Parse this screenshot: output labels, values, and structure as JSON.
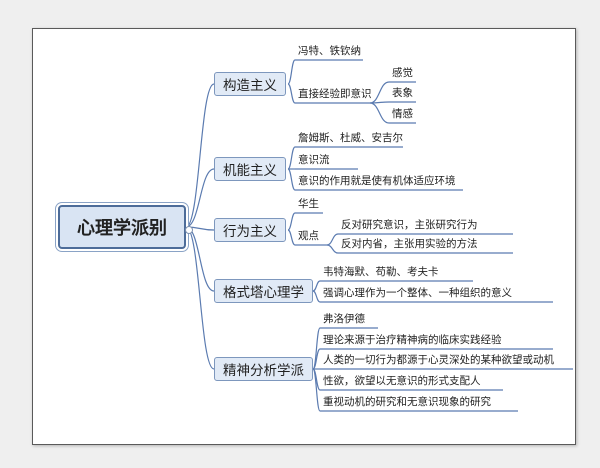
{
  "root": {
    "label": "心理学派别"
  },
  "branches": [
    {
      "label": "构造主义",
      "items": [
        {
          "label": "冯特、铁钦纳"
        },
        {
          "label": "直接经验即意识",
          "children": [
            "感觉",
            "表象",
            "情感"
          ]
        }
      ]
    },
    {
      "label": "机能主义",
      "items": [
        {
          "label": "詹姆斯、杜威、安吉尔"
        },
        {
          "label": "意识流"
        },
        {
          "label": "意识的作用就是使有机体适应环境"
        }
      ]
    },
    {
      "label": "行为主义",
      "items": [
        {
          "label": "华生"
        },
        {
          "label": "观点",
          "children": [
            "反对研究意识，主张研究行为",
            "反对内省，主张用实验的方法"
          ]
        }
      ]
    },
    {
      "label": "格式塔心理学",
      "items": [
        {
          "label": "韦特海默、苟勒、考夫卡"
        },
        {
          "label": "强调心理作为一个整体、一种组织的意义"
        }
      ]
    },
    {
      "label": "精神分析学派",
      "items": [
        {
          "label": "弗洛伊德"
        },
        {
          "label": "理论来源于治疗精神病的临床实践经验"
        },
        {
          "label": "人类的一切行为都源于心灵深处的某种欲望或动机"
        },
        {
          "label": "性欲，欲望以无意识的形式支配人"
        },
        {
          "label": "重视动机的研究和无意识现象的研究"
        }
      ]
    }
  ],
  "colors": {
    "line": "#5b7bb0",
    "node_fill": "#e1eaf6",
    "root_fill": "#d9e4f3"
  }
}
